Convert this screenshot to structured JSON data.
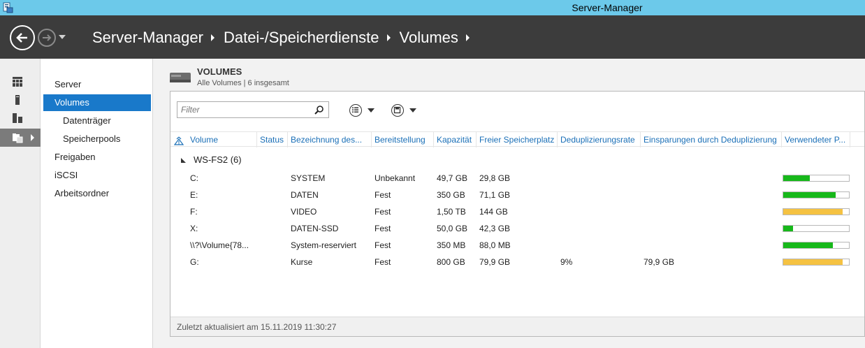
{
  "window": {
    "title": "Server-Manager"
  },
  "breadcrumb": [
    "Server-Manager",
    "Datei-/Speicherdienste",
    "Volumes"
  ],
  "rail": {
    "icons": [
      "dashboard-icon",
      "local-server-icon",
      "all-servers-icon",
      "file-storage-icon"
    ]
  },
  "nav": {
    "items": [
      {
        "label": "Server",
        "sub": false,
        "active": false
      },
      {
        "label": "Volumes",
        "sub": false,
        "active": true
      },
      {
        "label": "Datenträger",
        "sub": true,
        "active": false
      },
      {
        "label": "Speicherpools",
        "sub": true,
        "active": false
      },
      {
        "label": "Freigaben",
        "sub": false,
        "active": false
      },
      {
        "label": "iSCSI",
        "sub": false,
        "active": false
      },
      {
        "label": "Arbeitsordner",
        "sub": false,
        "active": false
      }
    ]
  },
  "tile": {
    "title": "VOLUMES",
    "subtitle": "Alle Volumes | 6 insgesamt"
  },
  "filter": {
    "placeholder": "Filter"
  },
  "columns": [
    "Volume",
    "Status",
    "Bezeichnung des...",
    "Bereitstellung",
    "Kapazität",
    "Freier Speicherplatz",
    "Deduplizierungsrate",
    "Einsparungen durch Deduplizierung",
    "Verwendeter P..."
  ],
  "group": {
    "label": "WS-FS2 (6)"
  },
  "rows": [
    {
      "volume": "C:",
      "status": "",
      "label": "SYSTEM",
      "provisioning": "Unbekannt",
      "capacity": "49,7 GB",
      "free": "29,8 GB",
      "dedup_rate": "",
      "dedup_savings": "",
      "used_percent": 40,
      "used_color": "#17b81a"
    },
    {
      "volume": "E:",
      "status": "",
      "label": "DATEN",
      "provisioning": "Fest",
      "capacity": "350 GB",
      "free": "71,1 GB",
      "dedup_rate": "",
      "dedup_savings": "",
      "used_percent": 80,
      "used_color": "#17b81a"
    },
    {
      "volume": "F:",
      "status": "",
      "label": "VIDEO",
      "provisioning": "Fest",
      "capacity": "1,50 TB",
      "free": "144 GB",
      "dedup_rate": "",
      "dedup_savings": "",
      "used_percent": 90,
      "used_color": "#f5c242"
    },
    {
      "volume": "X:",
      "status": "",
      "label": "DATEN-SSD",
      "provisioning": "Fest",
      "capacity": "50,0 GB",
      "free": "42,3 GB",
      "dedup_rate": "",
      "dedup_savings": "",
      "used_percent": 15,
      "used_color": "#17b81a"
    },
    {
      "volume": "\\\\?\\Volume{78...",
      "status": "",
      "label": "System-reserviert",
      "provisioning": "Fest",
      "capacity": "350 MB",
      "free": "88,0 MB",
      "dedup_rate": "",
      "dedup_savings": "",
      "used_percent": 75,
      "used_color": "#17b81a"
    },
    {
      "volume": "G:",
      "status": "",
      "label": "Kurse",
      "provisioning": "Fest",
      "capacity": "800 GB",
      "free": "79,9 GB",
      "dedup_rate": "9%",
      "dedup_savings": "79,9 GB",
      "used_percent": 90,
      "used_color": "#f5c242"
    }
  ],
  "footer": {
    "text": "Zuletzt aktualisiert am 15.11.2019 11:30:27"
  }
}
